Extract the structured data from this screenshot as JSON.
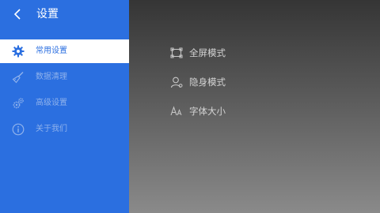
{
  "header": {
    "title": "设置"
  },
  "sidebar": {
    "items": [
      {
        "label": "常用设置",
        "icon": "gear-icon",
        "active": true
      },
      {
        "label": "数据清理",
        "icon": "broom-icon",
        "active": false
      },
      {
        "label": "高级设置",
        "icon": "gears-icon",
        "active": false
      },
      {
        "label": "关于我们",
        "icon": "info-icon",
        "active": false
      }
    ]
  },
  "options": [
    {
      "label": "全屏模式",
      "icon": "fullscreen-icon"
    },
    {
      "label": "隐身模式",
      "icon": "incognito-user-icon"
    },
    {
      "label": "字体大小",
      "icon": "font-size-icon"
    }
  ],
  "colors": {
    "accent": "#2b6fe0",
    "inactive_text": "#8fb2ec",
    "option_text": "#d4d4d4"
  }
}
